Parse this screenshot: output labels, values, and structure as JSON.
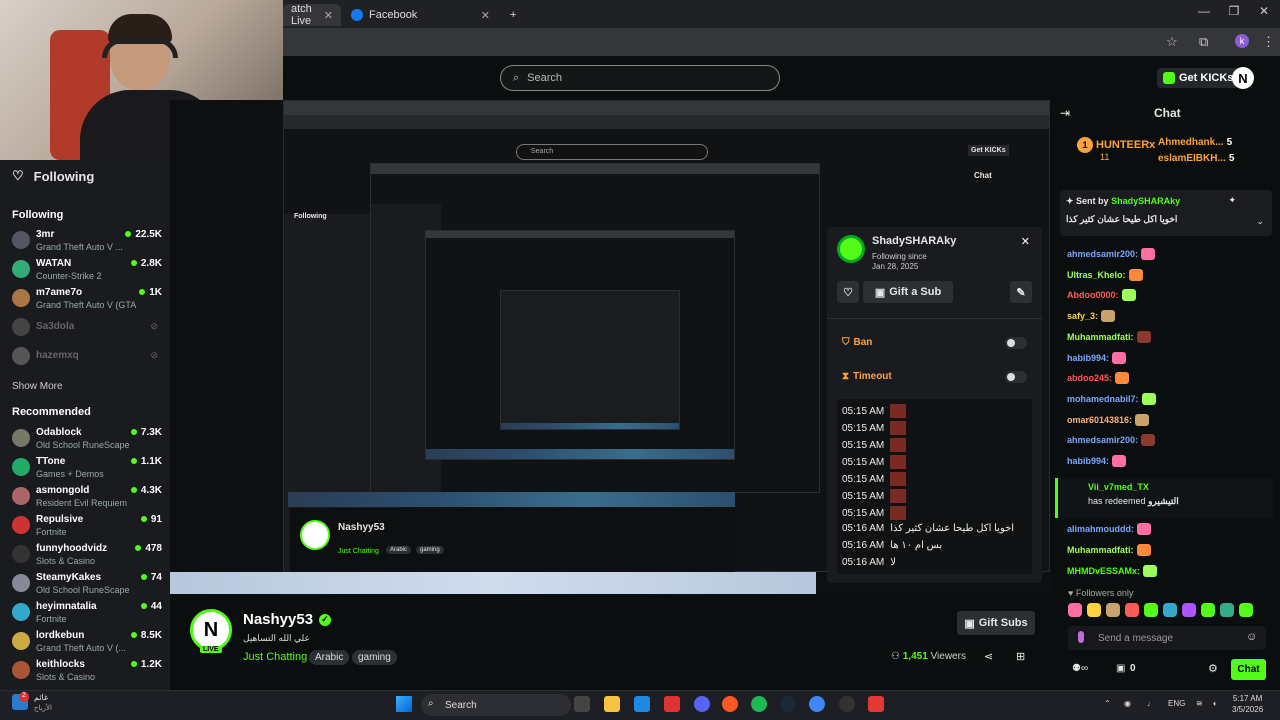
{
  "browser": {
    "tabs": [
      {
        "label": "atch Live"
      },
      {
        "label": "Facebook"
      }
    ],
    "new_tab": "+",
    "profile_initial": "k"
  },
  "site": {
    "search_placeholder": "Search",
    "get_kicks": "Get KICKs",
    "logo": "N"
  },
  "sidebar": {
    "following_header": "Following",
    "following_label": "Following",
    "show_more": "Show More",
    "recommended_label": "Recommended",
    "following": [
      {
        "name": "3mr",
        "category": "Grand Theft Auto V ...",
        "viewers": "22.5K",
        "color": "#556"
      },
      {
        "name": "WATAN",
        "category": "Counter-Strike 2",
        "viewers": "2.8K",
        "color": "#3a7"
      },
      {
        "name": "m7ame7o",
        "category": "Grand Theft Auto V (GTA)",
        "viewers": "1K",
        "color": "#a74"
      },
      {
        "name": "Sa3dola",
        "category": "",
        "viewers": "",
        "color": "#444"
      },
      {
        "name": "hazemxq",
        "category": "",
        "viewers": "",
        "color": "#555"
      }
    ],
    "recommended": [
      {
        "name": "Odablock",
        "category": "Old School RuneScape",
        "viewers": "7.3K",
        "color": "#776"
      },
      {
        "name": "TTone",
        "category": "Games + Demos",
        "viewers": "1.1K",
        "color": "#2a6"
      },
      {
        "name": "asmongold",
        "category": "Resident Evil Requiem",
        "viewers": "4.3K",
        "color": "#a66"
      },
      {
        "name": "Repulsive",
        "category": "Fortnite",
        "viewers": "91",
        "color": "#c33"
      },
      {
        "name": "funnyhoodvidz",
        "category": "Slots & Casino",
        "viewers": "478",
        "color": "#333"
      },
      {
        "name": "SteamyKakes",
        "category": "Old School RuneScape",
        "viewers": "74",
        "color": "#889"
      },
      {
        "name": "heyimnatalia",
        "category": "Fortnite",
        "viewers": "44",
        "color": "#3ac"
      },
      {
        "name": "lordkebun",
        "category": "Grand Theft Auto V (...",
        "viewers": "8.5K",
        "color": "#ca4"
      },
      {
        "name": "keithlocks",
        "category": "Slots & Casino",
        "viewers": "1.2K",
        "color": "#a53"
      }
    ]
  },
  "popup": {
    "name": "ShadySHARAky",
    "following_since_label": "Following since",
    "following_since_date": "Jan 28, 2025",
    "gift_sub": "Gift a Sub",
    "ban": "Ban",
    "timeout": "Timeout",
    "messages": [
      {
        "time": "05:15 AM",
        "text": ""
      },
      {
        "time": "05:15 AM",
        "text": ""
      },
      {
        "time": "05:15 AM",
        "text": ""
      },
      {
        "time": "05:15 AM",
        "text": ""
      },
      {
        "time": "05:15 AM",
        "text": ""
      },
      {
        "time": "05:15 AM",
        "text": ""
      },
      {
        "time": "05:15 AM",
        "text": ""
      },
      {
        "time": "05:16 AM",
        "text": "اخويا اكل طيحا عشان كثير كذا"
      },
      {
        "time": "05:16 AM",
        "text": "بس ام ١٠ ها"
      },
      {
        "time": "05:16 AM",
        "text": "لا"
      }
    ]
  },
  "stream": {
    "name": "Nashyy53",
    "subtitle": "علي الله التساهيل",
    "live": "LIVE",
    "category": "Just Chatting",
    "tags": [
      "Arabic",
      "gaming"
    ],
    "gift_subs": "Gift Subs",
    "viewers": "1,451",
    "viewers_label": "Viewers"
  },
  "nested": {
    "following": "Following",
    "name": "Nashyy53",
    "category": "Just Chatting",
    "tags": [
      "Arabic",
      "gaming"
    ],
    "search": "Search",
    "get_kicks": "Get KICKs",
    "chat": "Chat"
  },
  "chat": {
    "title": "Chat",
    "gifters": [
      {
        "name": "HUNTEERx",
        "count": "11",
        "rank": "1"
      },
      {
        "name": "Ahmedhank...",
        "count": "5"
      },
      {
        "name": "eslamEIBKH...",
        "count": "5"
      }
    ],
    "pinned_by_label": "Sent by",
    "pinned_by": "ShadySHARAky",
    "pinned_text": "اخويا اكل طيحا عشان كثير كذا",
    "messages": [
      {
        "user": "ahmedsamir200:",
        "color": "#7aa7ff"
      },
      {
        "user": "Ultras_Khelo:",
        "color": "#9dff5a"
      },
      {
        "user": "Abdoo0000:",
        "color": "#ff5a5a"
      },
      {
        "user": "safy_3:",
        "color": "#ffd23d"
      },
      {
        "user": "Muhammadfati:",
        "color": "#9dff5a"
      },
      {
        "user": "habib994:",
        "color": "#7aa7ff"
      },
      {
        "user": "abdoo245:",
        "color": "#ff5a5a"
      },
      {
        "user": "mohamednabil7:",
        "color": "#7aa7ff"
      },
      {
        "user": "omar60143816:",
        "color": "#ffb27a"
      },
      {
        "user": "ahmedsamir200:",
        "color": "#7aa7ff"
      },
      {
        "user": "habib994:",
        "color": "#7aa7ff"
      }
    ],
    "redeem_user": "Vii_v7med_TX",
    "redeem_text": "has redeemed",
    "redeem_reward": "التيشيرو",
    "messages2": [
      {
        "user": "alimahmouddd:",
        "color": "#7aa7ff"
      },
      {
        "user": "Muhammadfati:",
        "color": "#9dff5a"
      },
      {
        "user": "MHMDvESSAMx:",
        "color": "#53fc18"
      }
    ],
    "followers_only": "Followers only",
    "send_placeholder": "Send a message",
    "points": "0",
    "chat_button": "Chat"
  },
  "taskbar": {
    "weather": "غائم",
    "weather_sub": "الأرياح",
    "badge": "2",
    "search": "Search",
    "lang": "ENG",
    "time": "5:17 AM",
    "date": "3/5/2026"
  }
}
